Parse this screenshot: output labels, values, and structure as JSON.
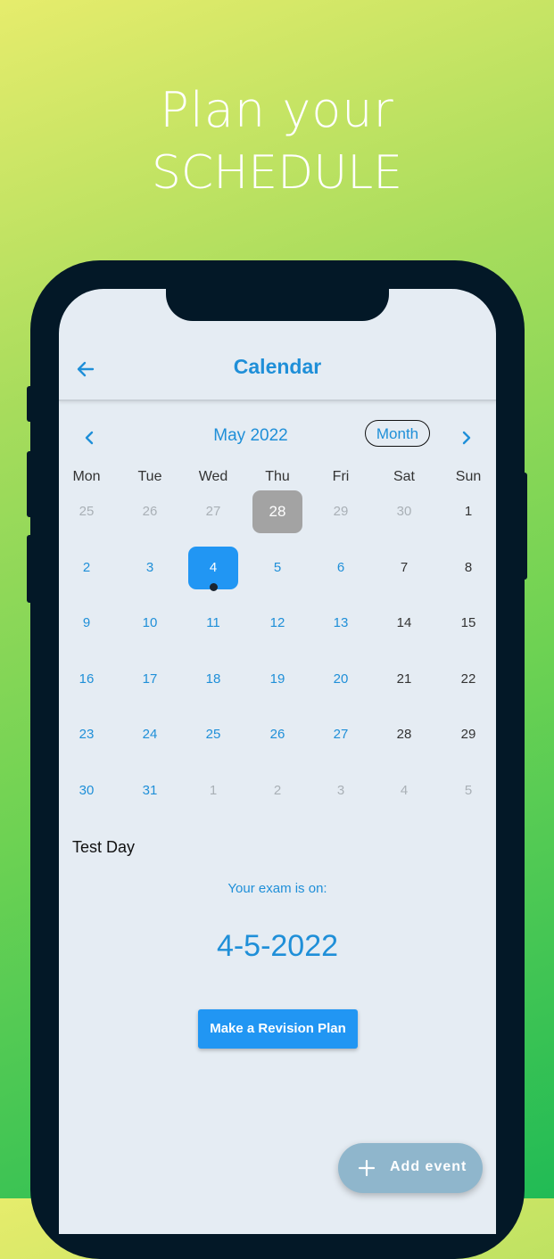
{
  "headline": {
    "line1": "Plan your",
    "line2": "SCHEDULE"
  },
  "app": {
    "title": "Calendar",
    "month_label": "May 2022",
    "view_mode": "Month",
    "weekdays": [
      "Mon",
      "Tue",
      "Wed",
      "Thu",
      "Fri",
      "Sat",
      "Sun"
    ],
    "weeks": [
      [
        "25",
        "26",
        "27",
        "28",
        "29",
        "30",
        "1"
      ],
      [
        "2",
        "3",
        "4",
        "5",
        "6",
        "7",
        "8"
      ],
      [
        "9",
        "10",
        "11",
        "12",
        "13",
        "14",
        "15"
      ],
      [
        "16",
        "17",
        "18",
        "19",
        "20",
        "21",
        "22"
      ],
      [
        "23",
        "24",
        "25",
        "26",
        "27",
        "28",
        "29"
      ],
      [
        "30",
        "31",
        "1",
        "2",
        "3",
        "4",
        "5"
      ]
    ],
    "today": "28",
    "selected": "4",
    "section_title": "Test Day",
    "exam_label": "Your exam is on:",
    "exam_date": "4-5-2022",
    "plan_button": "Make a Revision Plan",
    "add_event": "Add event"
  },
  "colors": {
    "accent": "#1f8fd8",
    "selected": "#2196f3",
    "today": "#a3a3a3"
  },
  "icons": [
    "back-arrow-icon",
    "chevron-left-icon",
    "chevron-right-icon",
    "plus-icon",
    "event-dot-icon"
  ]
}
